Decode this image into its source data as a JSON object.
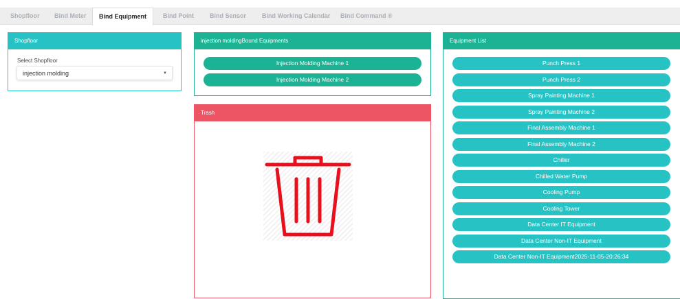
{
  "tabs": [
    {
      "label": "Shopfloor"
    },
    {
      "label": "Bind Meter"
    },
    {
      "label": "Bind Equipment"
    },
    {
      "label": "Bind Point"
    },
    {
      "label": "Bind Sensor"
    },
    {
      "label": "Bind Working Calendar"
    },
    {
      "label": "Bind Command ®"
    }
  ],
  "active_tab": "Bind Equipment",
  "shopfloor_panel": {
    "title": "Shopfloor",
    "select_label": "Select Shopfloor",
    "selected": "injection molding",
    "caret_icon": "caret-down-icon"
  },
  "bound_panel": {
    "title": "injection moldingBound Equipments",
    "items": [
      {
        "label": "Injection Molding Machine 1"
      },
      {
        "label": "Injection Molding Machine 2"
      }
    ]
  },
  "trash_panel": {
    "title": "Trash",
    "icon": "trash-icon",
    "icon_color": "#e8101c"
  },
  "equipment_panel": {
    "title": "Equipment List",
    "items": [
      {
        "label": "Punch Press 1"
      },
      {
        "label": "Punch Press 2"
      },
      {
        "label": "Spray Painting Machine 1"
      },
      {
        "label": "Spray Painting Machine 2"
      },
      {
        "label": "Final Assembly Machine 1"
      },
      {
        "label": "Final Assembly Machine 2"
      },
      {
        "label": "Chiller"
      },
      {
        "label": "Chilled Water Pump"
      },
      {
        "label": "Cooling Pump"
      },
      {
        "label": "Cooling Tower"
      },
      {
        "label": "Data Center IT Equipment"
      },
      {
        "label": "Data Center Non-IT Equipment"
      },
      {
        "label": "Data Center Non-IT Equipment2025-11-05-20:26:34"
      }
    ]
  },
  "colors": {
    "teal": "#27c2c4",
    "green": "#1bb393",
    "red": "#ed5565"
  }
}
